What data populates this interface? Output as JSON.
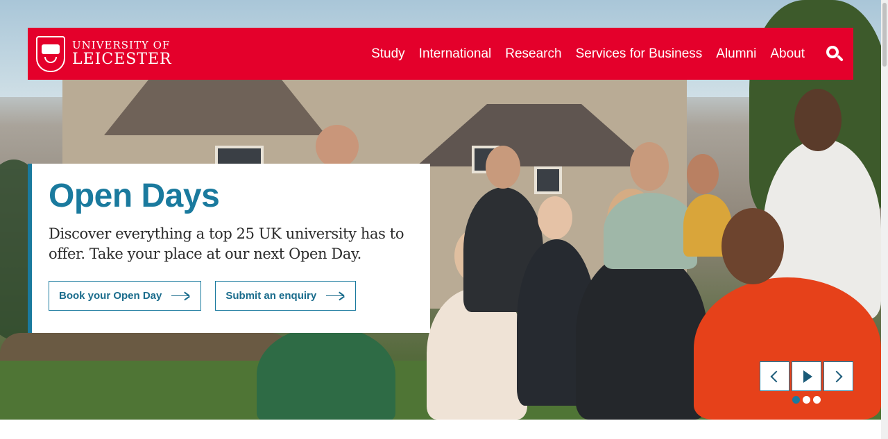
{
  "brand": {
    "line1": "UNIVERSITY OF",
    "line2": "LEICESTER",
    "color": "#e4002b",
    "accent": "#1a7a9e"
  },
  "nav": {
    "items": [
      {
        "label": "Study"
      },
      {
        "label": "International"
      },
      {
        "label": "Research"
      },
      {
        "label": "Services for Business"
      },
      {
        "label": "Alumni"
      },
      {
        "label": "About"
      }
    ],
    "search_icon": "search-icon"
  },
  "hero": {
    "title": "Open Days",
    "description": "Discover everything a top 25 UK university has to offer. Take your place at our next Open Day.",
    "buttons": [
      {
        "label": "Book your Open Day",
        "icon": "arrow-right-icon"
      },
      {
        "label": "Submit an enquiry",
        "icon": "arrow-right-icon"
      }
    ]
  },
  "carousel": {
    "controls": [
      "chevron-left-icon",
      "play-icon",
      "chevron-right-icon"
    ],
    "slide_count": 3,
    "active_slide": 1
  }
}
